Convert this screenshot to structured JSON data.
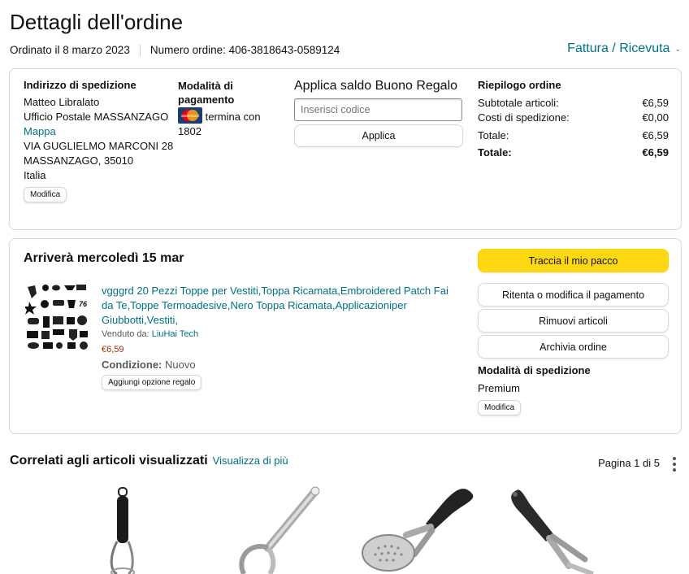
{
  "page": {
    "title": "Dettagli dell'ordine",
    "ordered_on": "Ordinato il 8 marzo 2023",
    "order_number": "Numero ordine: 406-3818643-0589124",
    "invoice_link": "Fattura / Ricevuta"
  },
  "shipping_address": {
    "heading": "Indirizzo di spedizione",
    "name": "Matteo Libralato",
    "line1": "Ufficio Postale MASSANZAGO",
    "map_link": "Mappa",
    "line2": "VIA GUGLIELMO MARCONI 28",
    "line3": "MASSANZAGO, 35010",
    "country": "Italia",
    "edit_label": "Modifica"
  },
  "payment": {
    "heading": "Modalità di pagamento",
    "card_text": "termina con 1802",
    "card_brand_text": "MasterCard"
  },
  "gift": {
    "heading": "Applica saldo Buono Regalo",
    "placeholder": "Inserisci codice",
    "apply_label": "Applica"
  },
  "summary": {
    "heading": "Riepilogo ordine",
    "rows": [
      {
        "label": "Subtotale articoli:",
        "value": "€6,59"
      },
      {
        "label": "Costi di spedizione:",
        "value": "€0,00"
      },
      {
        "label": "Totale:",
        "value": "€6,59"
      },
      {
        "label": "Totale:",
        "value": "€6,59"
      }
    ]
  },
  "shipment": {
    "arrival": "Arriverà mercoledì 15 mar",
    "product_title": "vgggrd 20 Pezzi Toppe per Vestiti,Toppa Ricamata,Embroidered Patch Fai da Te,Toppe Termoadesive,Nero Toppa Ricamata,Applicazioniper Giubbotti,Vestiti,",
    "sold_by_label": "Venduto da:",
    "seller": "LiuHai Tech",
    "price": "€6,59",
    "condition_label": "Condizione:",
    "condition_value": "Nuovo",
    "gift_option_label": "Aggiungi opzione regalo",
    "track_label": "Traccia il mio pacco",
    "retry_payment_label": "Ritenta o modifica il pagamento",
    "remove_items_label": "Rimuovi articoli",
    "archive_label": "Archivia ordine",
    "shipping_method_heading": "Modalità di spedizione",
    "shipping_method_value": "Premium",
    "shipping_edit_label": "Modifica"
  },
  "related": {
    "heading": "Correlati agli articoli visualizzati",
    "see_more": "Visualizza di più",
    "pagination": "Pagina 1 di 5"
  },
  "colors": {
    "link": "#007185",
    "price": "#b12704",
    "track_button": "#ffd814",
    "border": "#d5d9d9"
  }
}
